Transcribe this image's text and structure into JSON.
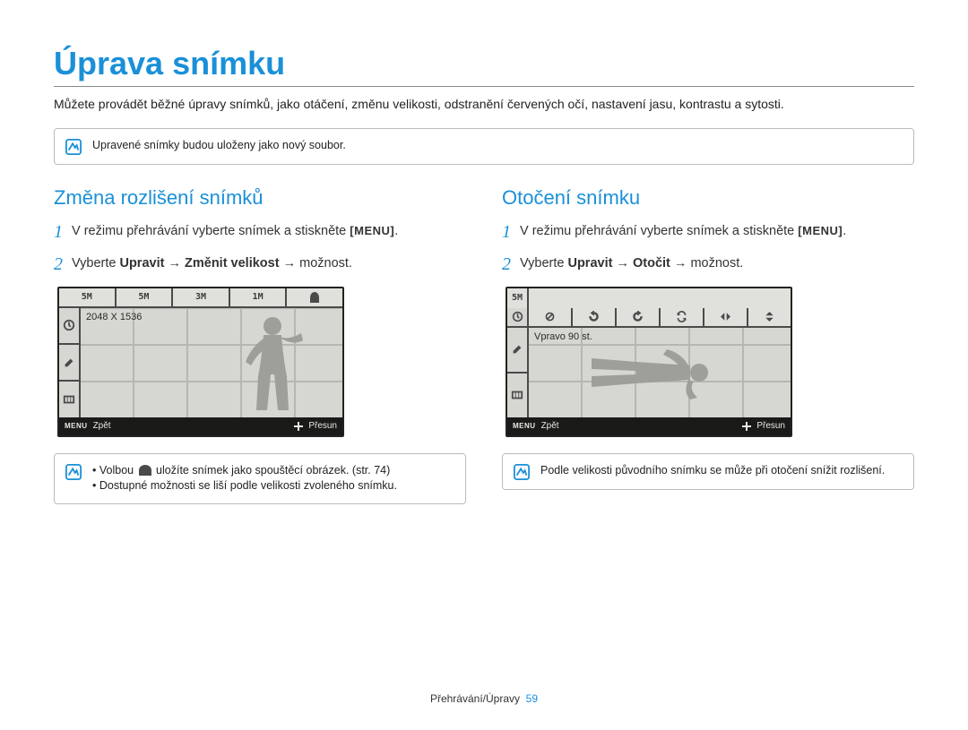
{
  "page": {
    "title": "Úprava snímku",
    "intro": "Můžete provádět běžné úpravy snímků, jako otáčení, změnu velikosti, odstranění červených očí, nastavení jasu, kontrastu a sytosti.",
    "topnote": "Upravené snímky budou uloženy jako nový soubor."
  },
  "left": {
    "heading": "Změna rozlišení snímků",
    "step1_pre": "V režimu přehrávání vyberte snímek a stiskněte ",
    "step1_menu": "[MENU]",
    "step1_post": ".",
    "step2_pre": "Vyberte ",
    "step2_b1": "Upravit",
    "step2_arrow1": " → ",
    "step2_b2": "Změnit velikost",
    "step2_arrow2": " → ",
    "step2_post": "možnost.",
    "screen": {
      "topcells": [
        "5M",
        "5M",
        "3M",
        "1M"
      ],
      "value": "2048 X 1536",
      "bottom_back_label": "Zpět",
      "bottom_move_label": "Přesun",
      "bottom_menu": "MENU"
    },
    "note_l1_pre": "Volbou ",
    "note_l1_post": " uložíte snímek jako spouštěcí obrázek. (str. 74)",
    "note_l2": "Dostupné možnosti se liší podle velikosti zvoleného snímku."
  },
  "right": {
    "heading": "Otočení snímku",
    "step1_pre": "V režimu přehrávání vyberte snímek a stiskněte ",
    "step1_menu": "[MENU]",
    "step1_post": ".",
    "step2_pre": "Vyberte ",
    "step2_b1": "Upravit",
    "step2_arrow1": " → ",
    "step2_b2": "Otočit",
    "step2_arrow2": " → ",
    "step2_post": "možnost.",
    "screen": {
      "topcell": "5M",
      "value": "Vpravo 90 st.",
      "bottom_back_label": "Zpět",
      "bottom_move_label": "Přesun",
      "bottom_menu": "MENU"
    },
    "note": "Podle velikosti původního snímku se může při otočení snížit rozlišení."
  },
  "footer": {
    "section": "Přehrávání/Úpravy",
    "page": "59"
  },
  "numbers": {
    "one": "1",
    "two": "2"
  }
}
